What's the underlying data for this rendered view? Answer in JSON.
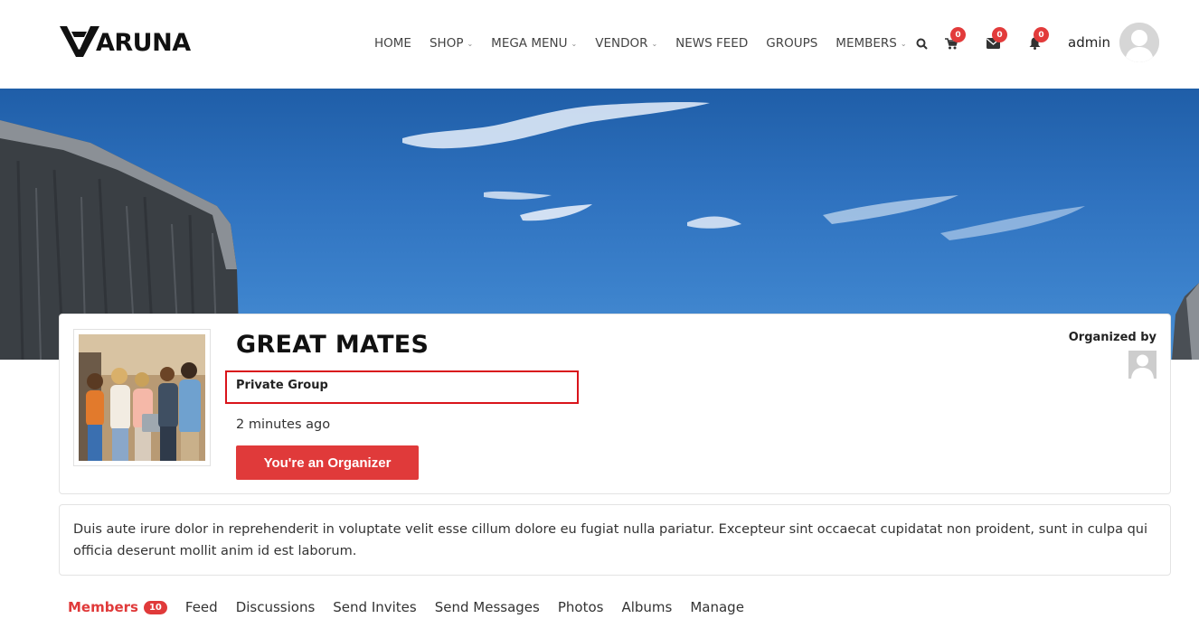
{
  "brand": {
    "logo_text": "ARUNA"
  },
  "nav": {
    "items": [
      {
        "label": "HOME",
        "dropdown": false
      },
      {
        "label": "SHOP",
        "dropdown": true
      },
      {
        "label": "MEGA MENU",
        "dropdown": true
      },
      {
        "label": "VENDOR",
        "dropdown": true
      },
      {
        "label": "NEWS FEED",
        "dropdown": false
      },
      {
        "label": "GROUPS",
        "dropdown": false
      },
      {
        "label": "MEMBERS",
        "dropdown": true
      }
    ],
    "cart_count": "0",
    "messages_count": "0",
    "notifications_count": "0",
    "user_name": "admin"
  },
  "group": {
    "title": "GREAT MATES",
    "privacy": "Private Group",
    "time_ago": "2 minutes ago",
    "organizer_button": "You're an Organizer",
    "organized_by_label": "Organized by",
    "description": "Duis aute irure dolor in reprehenderit in voluptate velit esse cillum dolore eu fugiat nulla pariatur. Excepteur sint occaecat cupidatat non proident, sunt in culpa qui officia deserunt mollit anim id est laborum."
  },
  "tabs": [
    {
      "label": "Members",
      "count": "10",
      "active": true
    },
    {
      "label": "Feed"
    },
    {
      "label": "Discussions"
    },
    {
      "label": "Send Invites"
    },
    {
      "label": "Send Messages"
    },
    {
      "label": "Photos"
    },
    {
      "label": "Albums"
    },
    {
      "label": "Manage"
    }
  ],
  "colors": {
    "accent": "#e03a3a",
    "highlight_box": "#d9141b",
    "badge": "#e23b3b"
  }
}
